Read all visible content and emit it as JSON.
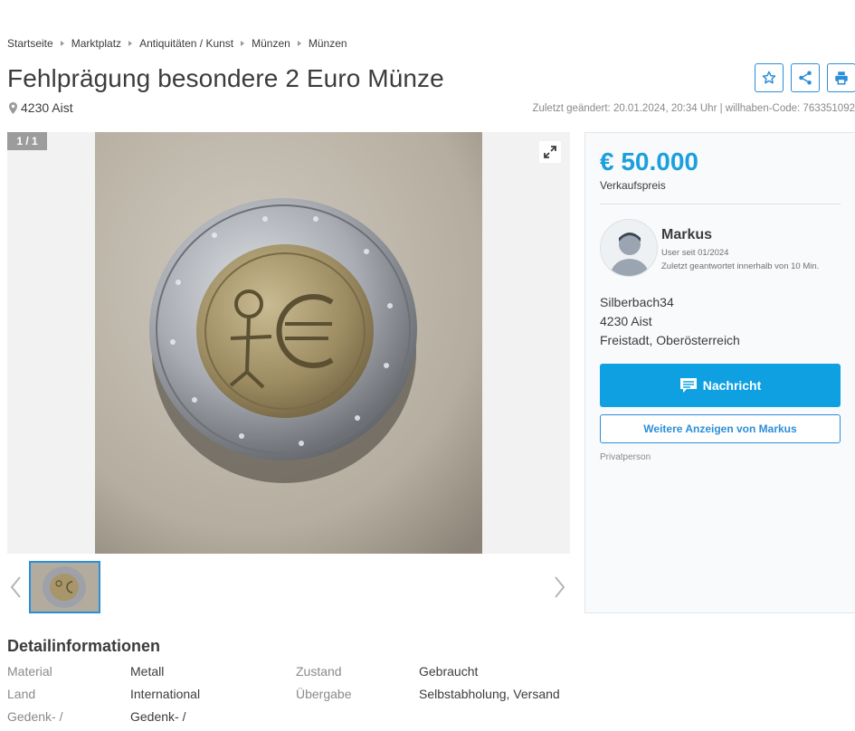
{
  "breadcrumb": [
    "Startseite",
    "Marktplatz",
    "Antiquitäten / Kunst",
    "Münzen",
    "Münzen"
  ],
  "title": "Fehlprägung besondere 2 Euro Münze",
  "location": "4230 Aist",
  "meta": "Zuletzt geändert: 20.01.2024, 20:34 Uhr | willhaben-Code: 763351092",
  "actions": [
    {
      "name": "favorite-button",
      "icon": "star-icon"
    },
    {
      "name": "share-button",
      "icon": "share-icon"
    },
    {
      "name": "print-button",
      "icon": "printer-icon"
    }
  ],
  "gallery": {
    "counter": "1 / 1",
    "expand_icon": "expand-icon"
  },
  "sidebar": {
    "price": "€ 50.000",
    "price_label": "Verkaufspreis",
    "seller_name": "Markus",
    "seller_since": "User seit 01/2024",
    "seller_reply": "Zuletzt geantwortet innerhalb von 10 Min.",
    "address": [
      "Silberbach34",
      "4230 Aist",
      "Freistadt, Oberösterreich"
    ],
    "message_button": "Nachricht",
    "more_button": "Weitere Anzeigen von Markus",
    "seller_type": "Privatperson"
  },
  "details": {
    "title": "Detailinformationen",
    "rows": [
      {
        "k1": "Material",
        "v1": "Metall",
        "k2": "Zustand",
        "v2": "Gebraucht"
      },
      {
        "k1": "Land",
        "v1": "International",
        "k2": "Übergabe",
        "v2": "Selbstabholung, Versand"
      },
      {
        "k1": "Gedenk- /",
        "v1": "Gedenk- /",
        "k2": "",
        "v2": ""
      }
    ]
  },
  "colors": {
    "accent": "#2b8ed8",
    "price": "#1ca0dd",
    "message_button": "#0fa0e2"
  }
}
